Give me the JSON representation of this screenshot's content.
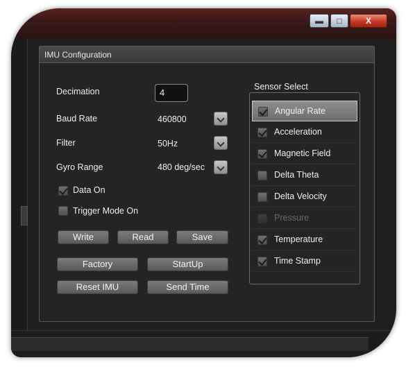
{
  "window": {
    "minimize_glyph": "▬",
    "maximize_glyph": "□",
    "close_glyph": "X"
  },
  "panel": {
    "title": "IMU Configuration"
  },
  "fields": {
    "decimation": {
      "label": "Decimation",
      "value": "4"
    },
    "baud_rate": {
      "label": "Baud Rate",
      "value": "460800"
    },
    "filter": {
      "label": "Filter",
      "value": "50Hz"
    },
    "gyro_range": {
      "label": "Gyro Range",
      "value": "480 deg/sec"
    }
  },
  "options": {
    "data_on": {
      "label": "Data On",
      "checked": true
    },
    "trigger_mode_on": {
      "label": "Trigger Mode On",
      "checked": false
    }
  },
  "buttons": {
    "write": "Write",
    "read": "Read",
    "save": "Save",
    "factory": "Factory",
    "startup": "StartUp",
    "reset_imu": "Reset IMU",
    "send_time": "Send Time"
  },
  "sensor_select": {
    "title": "Sensor Select",
    "items": [
      {
        "label": "Angular Rate",
        "checked": true,
        "selected": true,
        "enabled": true
      },
      {
        "label": "Acceleration",
        "checked": true,
        "selected": false,
        "enabled": true
      },
      {
        "label": "Magnetic Field",
        "checked": true,
        "selected": false,
        "enabled": true
      },
      {
        "label": "Delta Theta",
        "checked": false,
        "selected": false,
        "enabled": true
      },
      {
        "label": "Delta Velocity",
        "checked": false,
        "selected": false,
        "enabled": true
      },
      {
        "label": "Pressure",
        "checked": false,
        "selected": false,
        "enabled": false
      },
      {
        "label": "Temperature",
        "checked": true,
        "selected": false,
        "enabled": true
      },
      {
        "label": "Time Stamp",
        "checked": true,
        "selected": false,
        "enabled": true
      }
    ]
  },
  "colors": {
    "background": "#242424",
    "text": "#eeeeee",
    "close_button": "#c53b24"
  }
}
